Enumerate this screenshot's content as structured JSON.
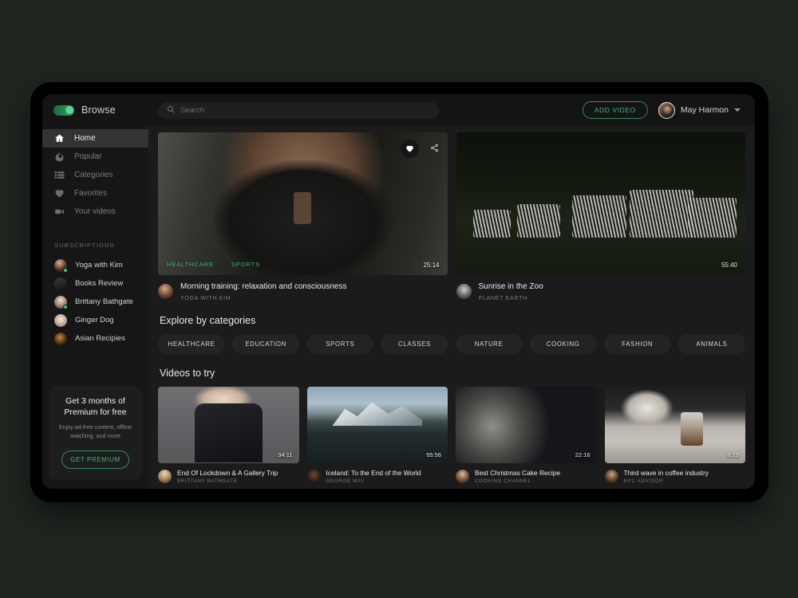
{
  "app": {
    "brand": "Browse",
    "toggle_on": true,
    "accent_green": "#43b87a",
    "page_background": "#1f2620"
  },
  "search": {
    "value": "",
    "placeholder": "Search"
  },
  "topbar": {
    "add_video_label": "ADD VIDEO",
    "user_name": "May Harmon",
    "caret_icon": "chevron-down-icon",
    "search_icon": "search-icon"
  },
  "sidebar": {
    "nav": [
      {
        "label": "Home",
        "icon": "home-icon",
        "active": true
      },
      {
        "label": "Popular",
        "icon": "flame-icon",
        "active": false
      },
      {
        "label": "Categories",
        "icon": "list-icon",
        "active": false
      },
      {
        "label": "Favorites",
        "icon": "heart-icon",
        "active": false
      },
      {
        "label": "Your videos",
        "icon": "video-camera-icon",
        "active": false
      }
    ],
    "subscriptions_title": "SUBSCRIPTIONS",
    "subscriptions": [
      {
        "name": "Yoga with Kim",
        "online": true
      },
      {
        "name": "Books Review",
        "online": false
      },
      {
        "name": "Brittany Bathgate",
        "online": true
      },
      {
        "name": "Ginger Dog",
        "online": false
      },
      {
        "name": "Asian Recipies",
        "online": false
      }
    ],
    "premium": {
      "title": "Get 3 months of Premium for free",
      "subtitle": "Enjoy ad-free content, offline watching, and more",
      "button": "GET PREMIUM"
    }
  },
  "main": {
    "hero": [
      {
        "title": "Morning training: relaxation and consciousness",
        "channel": "YOGA WITH KIM",
        "duration": "25:14",
        "tags": [
          "HEALTHCARE",
          "SPORTS"
        ],
        "favorite_icon": "heart-icon",
        "share_icon": "share-icon"
      },
      {
        "title": "Sunrise in the Zoo",
        "channel": "PLANET EARTH",
        "duration": "55:40",
        "tags": []
      }
    ],
    "categories_title": "Explore by categories",
    "categories": [
      "HEALTHCARE",
      "EDUCATION",
      "SPORTS",
      "CLASSES",
      "NATURE",
      "COOKING",
      "FASHION",
      "ANIMALS"
    ],
    "videos_title": "Videos to try",
    "videos": [
      {
        "title": "End Of Lockdown & A Gallery Trip",
        "channel": "BRITTANY BATHGATE",
        "duration": "34:11"
      },
      {
        "title": "Iceland: To the End of the World",
        "channel": "GEORGE MAY",
        "duration": "55:56"
      },
      {
        "title": "Best Christmas Cake Recipe",
        "channel": "COOKING CHANNEL",
        "duration": "22:16"
      },
      {
        "title": "Third wave in coffee industry",
        "channel": "NYC ADVISOR",
        "duration": "8:19"
      }
    ]
  }
}
